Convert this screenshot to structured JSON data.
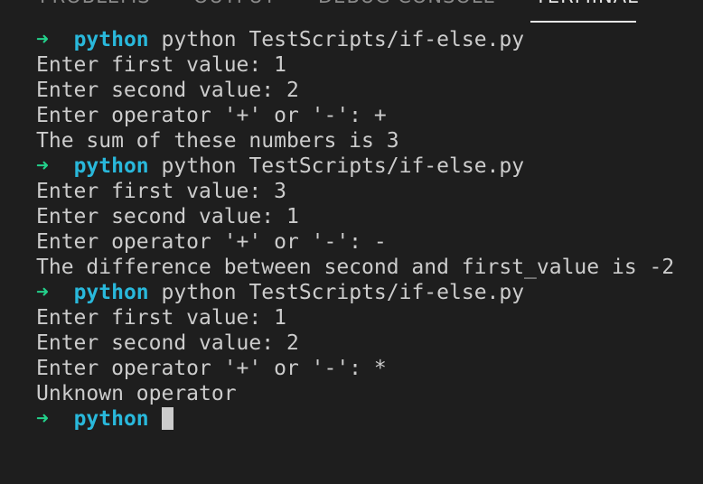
{
  "panel": {
    "tabs": [
      {
        "label": "PROBLEMS"
      },
      {
        "label": "OUTPUT"
      },
      {
        "label": "DEBUG CONSOLE"
      },
      {
        "label": "TERMINAL"
      }
    ],
    "active_tab": "TERMINAL"
  },
  "terminal": {
    "prompt_symbol": "➜",
    "cwd": "python",
    "lines": [
      {
        "type": "prompt",
        "cmd": "python TestScripts/if-else.py"
      },
      {
        "type": "out",
        "text": "Enter first value: 1"
      },
      {
        "type": "out",
        "text": "Enter second value: 2"
      },
      {
        "type": "out",
        "text": "Enter operator '+' or '-': +"
      },
      {
        "type": "out",
        "text": "The sum of these numbers is 3"
      },
      {
        "type": "prompt",
        "cmd": "python TestScripts/if-else.py"
      },
      {
        "type": "out",
        "text": "Enter first value: 3"
      },
      {
        "type": "out",
        "text": "Enter second value: 1"
      },
      {
        "type": "out",
        "text": "Enter operator '+' or '-': -"
      },
      {
        "type": "out",
        "text": "The difference between second and first_value is -2"
      },
      {
        "type": "prompt",
        "cmd": "python TestScripts/if-else.py"
      },
      {
        "type": "out",
        "text": "Enter first value: 1"
      },
      {
        "type": "out",
        "text": "Enter second value: 2"
      },
      {
        "type": "out",
        "text": "Enter operator '+' or '-': *"
      },
      {
        "type": "out",
        "text": "Unknown operator"
      },
      {
        "type": "prompt",
        "cmd": ""
      }
    ]
  },
  "colors": {
    "background": "#1e1e1e",
    "text": "#cccccc",
    "prompt_arrow": "#23d18b",
    "prompt_dir": "#29b8db"
  }
}
